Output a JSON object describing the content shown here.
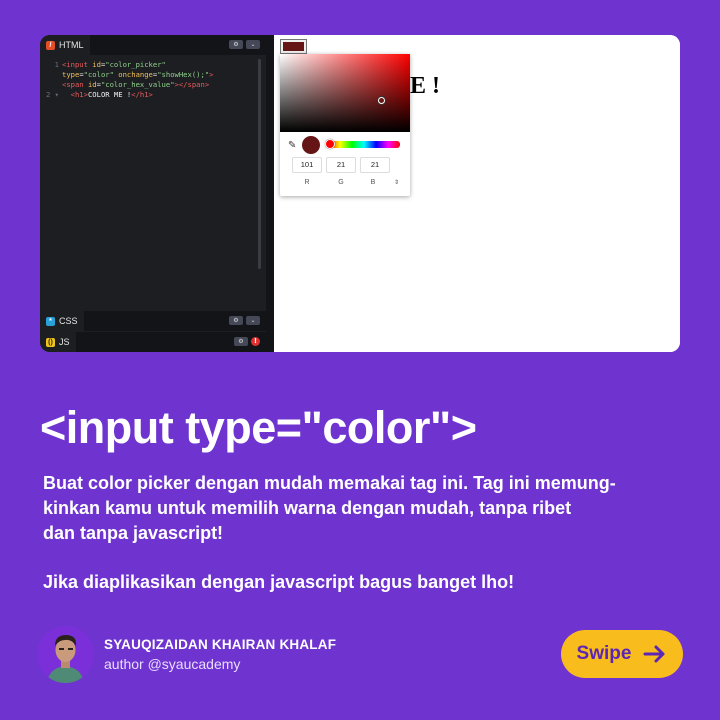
{
  "editor": {
    "html_tab": "HTML",
    "css_tab": "CSS",
    "js_tab": "JS",
    "settings_glyph": "⚙",
    "collapse_glyph": "⌄",
    "error_glyph": "!",
    "lines": [
      {
        "num": "1",
        "parts": [
          [
            "tag",
            "<input "
          ],
          [
            "attr",
            "id"
          ],
          [
            "src",
            "="
          ],
          [
            "val",
            "\"color_picker\""
          ]
        ]
      },
      {
        "num": "",
        "parts": [
          [
            "attr",
            "type"
          ],
          [
            "src",
            "="
          ],
          [
            "val",
            "\"color\" "
          ],
          [
            "attr",
            "onchange"
          ],
          [
            "src",
            "="
          ],
          [
            "val",
            "\"showHex();\""
          ],
          [
            "tag",
            ">"
          ]
        ]
      },
      {
        "num": "",
        "parts": [
          [
            "tag",
            "<span "
          ],
          [
            "attr",
            "id"
          ],
          [
            "src",
            "="
          ],
          [
            "val",
            "\"color_hex_value\""
          ],
          [
            "tag",
            "></span>"
          ]
        ]
      },
      {
        "num": "2 ▾",
        "parts": [
          [
            "src",
            "  "
          ],
          [
            "tag",
            "<h1>"
          ],
          [
            "txt",
            "COLOR ME !"
          ],
          [
            "tag",
            "</h1>"
          ]
        ]
      }
    ]
  },
  "preview": {
    "heading_visible": "E !",
    "swatch_color": "#651515",
    "picker": {
      "r": "101",
      "g": "21",
      "b": "21",
      "r_label": "R",
      "g_label": "G",
      "b_label": "B",
      "spin_glyph": "⇕",
      "dropper_glyph": "✎"
    }
  },
  "headline": "<input type=\"color\">",
  "description_lines": [
    "Buat color picker dengan mudah memakai tag ini. Tag ini memung-",
    "kinkan kamu untuk memilih warna dengan mudah, tanpa ribet",
    "dan tanpa javascript!"
  ],
  "description_2": "Jika diaplikasikan dengan javascript bagus banget lho!",
  "author": {
    "name": "SYAUQIZAIDAN KHAIRAN KHALAF",
    "handle": "author @syaucademy"
  },
  "swipe": {
    "label": "Swipe"
  },
  "colors": {
    "background": "#6f34d0",
    "swipe_button": "#f9bc1d",
    "swipe_text": "#5c25b5",
    "picked": "#651515"
  }
}
